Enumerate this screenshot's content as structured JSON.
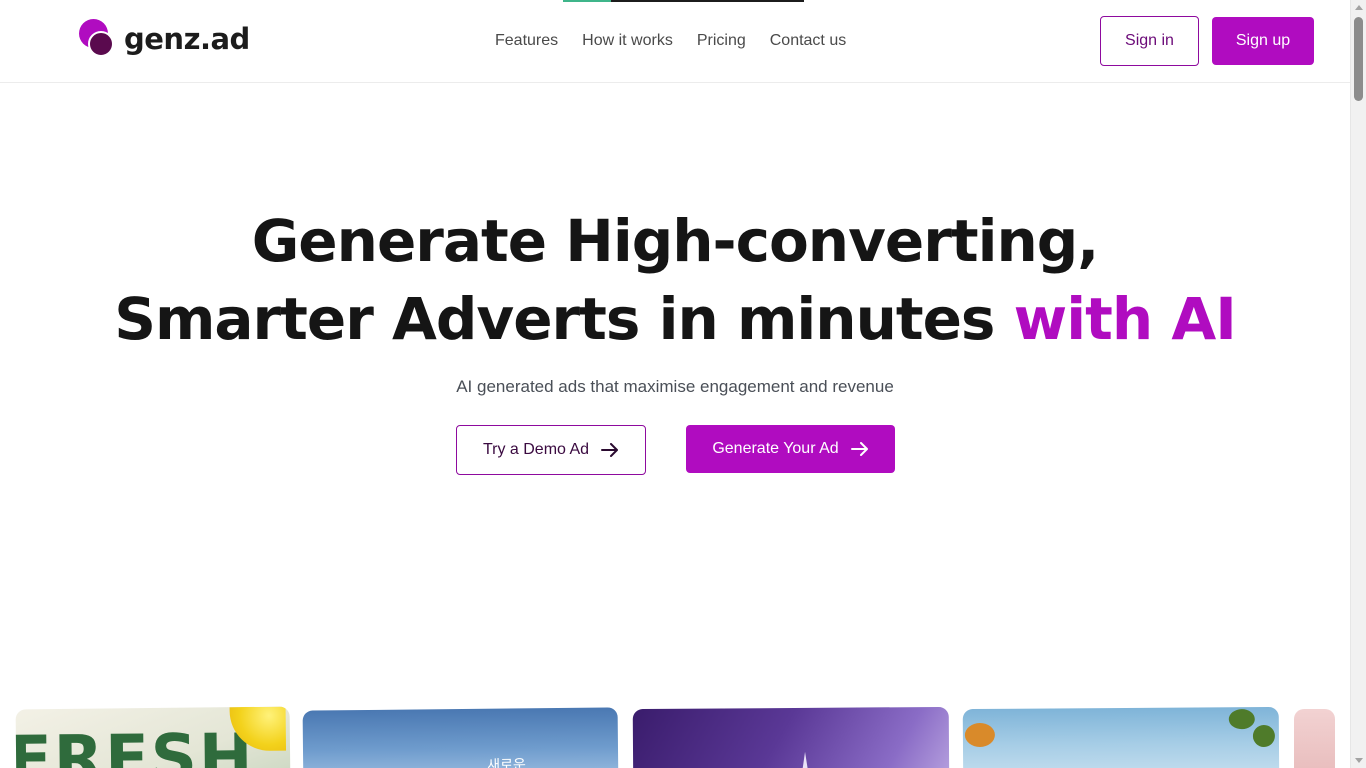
{
  "brand": {
    "name": "genz.ad",
    "accent_color": "#b00cc0",
    "dark_accent_color": "#5a0a4e"
  },
  "top_progress": {
    "fraction": 0.2
  },
  "nav": {
    "items": [
      {
        "label": "Features"
      },
      {
        "label": "How it works"
      },
      {
        "label": "Pricing"
      },
      {
        "label": "Contact us"
      }
    ]
  },
  "auth": {
    "signin_label": "Sign in",
    "signup_label": "Sign up"
  },
  "hero": {
    "title_line1": "Generate High-converting,",
    "title_line2": "Smarter Adverts in minutes",
    "title_accent": "with AI",
    "subtitle": "AI generated ads that maximise engagement and revenue",
    "demo_button_label": "Try a Demo Ad",
    "generate_button_label": "Generate Your Ad"
  },
  "showcase": {
    "cards": [
      {
        "name": "lemon-drink-ad",
        "visible_text": "FRESH"
      },
      {
        "name": "sky-korean-ad",
        "visible_text": "새로운"
      },
      {
        "name": "purple-gradient-ad",
        "visible_text": ""
      },
      {
        "name": "sky-birds-ad",
        "visible_text": ""
      },
      {
        "name": "pink-ad",
        "visible_text": ""
      }
    ]
  },
  "icons": {
    "arrow": "arrow-right-icon",
    "logo": "genz-logo-icon"
  }
}
